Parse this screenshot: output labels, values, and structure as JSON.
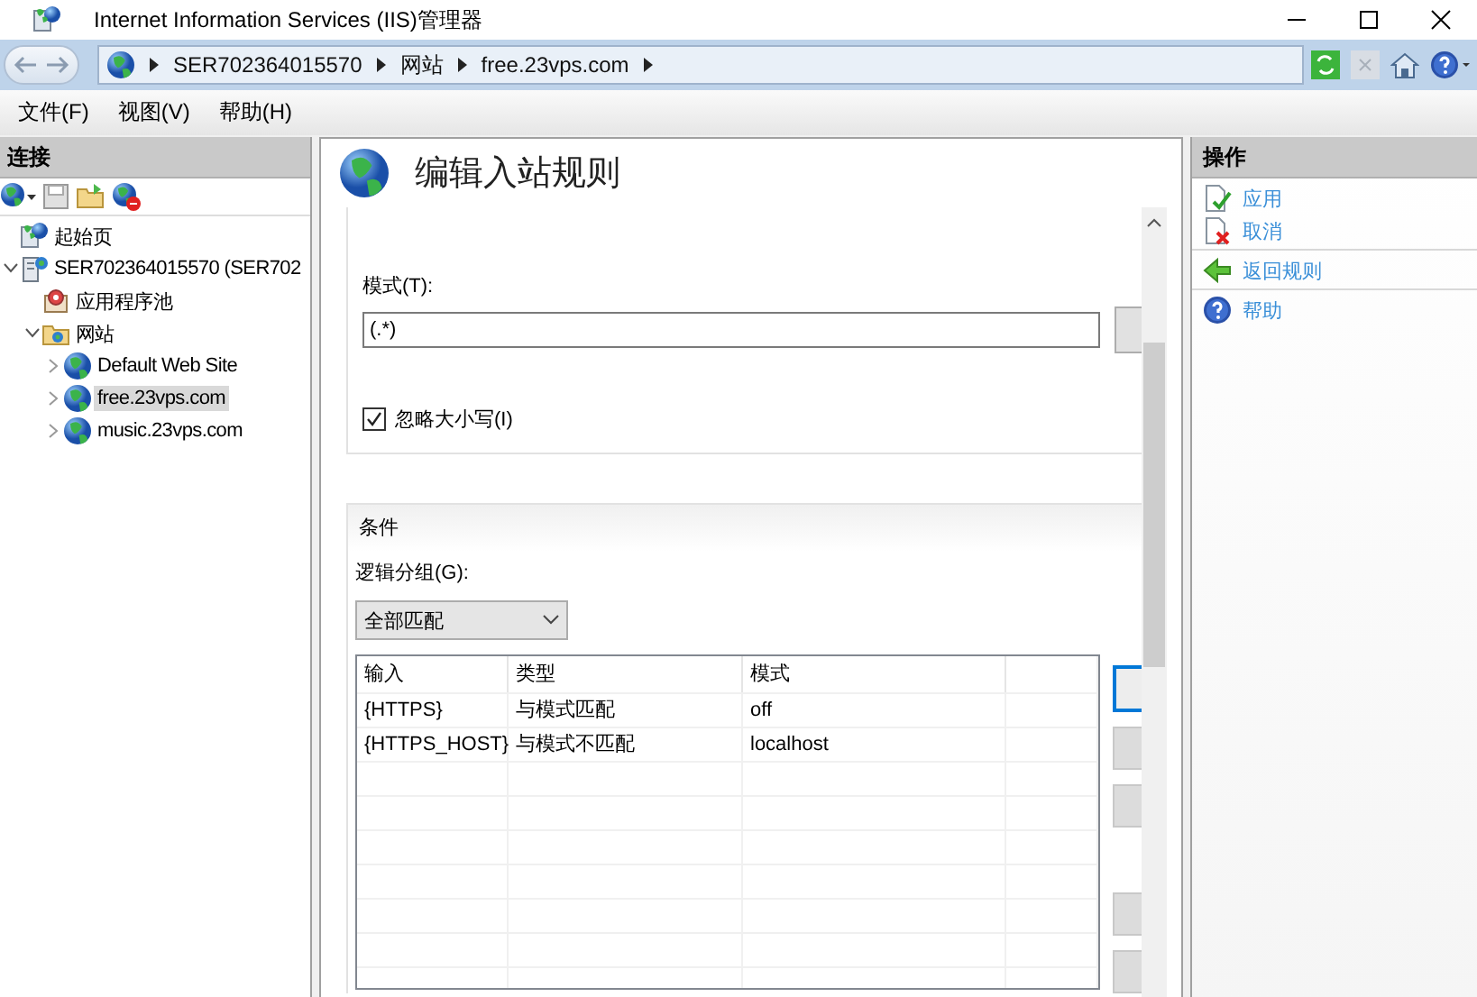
{
  "window": {
    "title": "Internet Information Services (IIS)管理器"
  },
  "breadcrumb": [
    "SER702364015570",
    "网站",
    "free.23vps.com"
  ],
  "menu": [
    "文件(F)",
    "视图(V)",
    "帮助(H)"
  ],
  "connections": {
    "title": "连接",
    "tree": [
      {
        "label": "起始页",
        "kind": "start",
        "selected": false
      },
      {
        "label": "SER702364015570 (SER702",
        "kind": "server",
        "selected": false,
        "expanded": true,
        "children": [
          {
            "label": "应用程序池",
            "kind": "pool",
            "selected": false
          },
          {
            "label": "网站",
            "kind": "folder",
            "selected": false,
            "expanded": true,
            "children": [
              {
                "label": "Default Web Site",
                "kind": "site",
                "selected": false,
                "expanded": false
              },
              {
                "label": "free.23vps.com",
                "kind": "site",
                "selected": true,
                "expanded": false
              },
              {
                "label": "music.23vps.com",
                "kind": "site",
                "selected": false,
                "expanded": false
              }
            ]
          }
        ]
      }
    ]
  },
  "editor": {
    "title": "编辑入站规则",
    "pattern_label": "模式(T):",
    "pattern_value": "(.*)",
    "ignore_case": {
      "label": "忽略大小写(I)",
      "checked": true
    },
    "conditions": {
      "title": "条件",
      "group_label": "逻辑分组(G):",
      "group_value": "全部匹配",
      "columns": [
        "输入",
        "类型",
        "模式"
      ],
      "rows": [
        [
          "{HTTPS}",
          "与模式匹配",
          "off"
        ],
        [
          "{HTTPS_HOST}",
          "与模式不匹配",
          "localhost"
        ]
      ]
    }
  },
  "actions": {
    "title": "操作",
    "groups": [
      [
        {
          "label": "应用",
          "kind": "apply"
        },
        {
          "label": "取消",
          "kind": "cancel"
        }
      ],
      [
        {
          "label": "返回规则",
          "kind": "back"
        }
      ],
      [
        {
          "label": "帮助",
          "kind": "help"
        }
      ]
    ]
  }
}
